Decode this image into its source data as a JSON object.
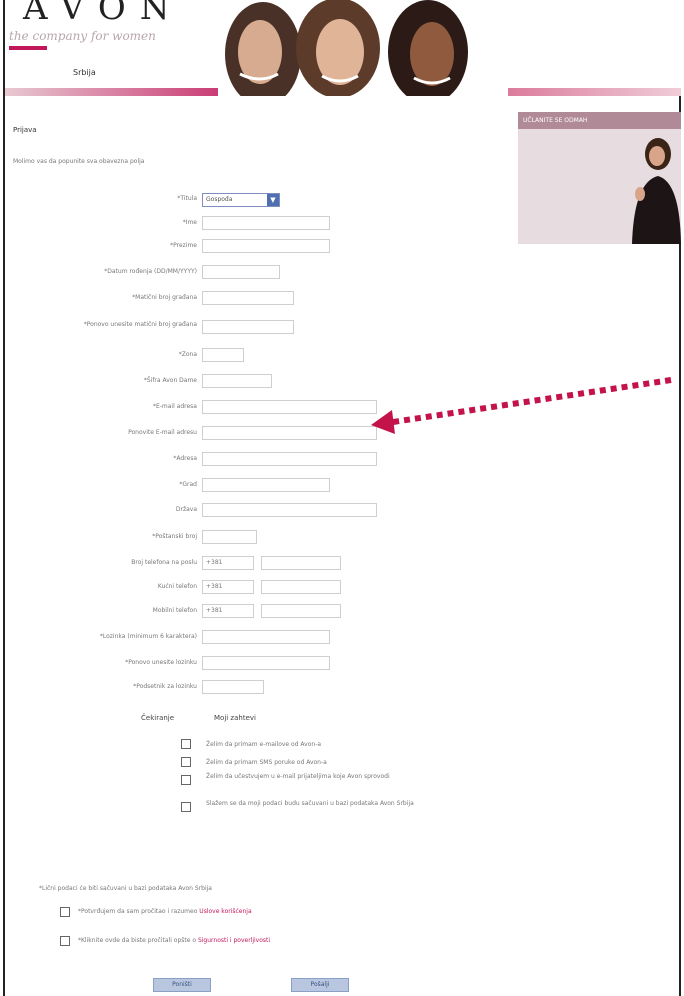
{
  "header": {
    "logo": "AVON",
    "tagline": "the company for women",
    "country": "Srbija"
  },
  "form": {
    "title": "Prijava",
    "note": "Molimo vas da popunite sva obavezna polja",
    "fields": [
      {
        "label": "*Titula",
        "value": "Gospođa"
      },
      {
        "label": "*Ime",
        "value": ""
      },
      {
        "label": "*Prezime",
        "value": ""
      },
      {
        "label": "*Datum rođenja (DD/MM/YYYY)",
        "value": ""
      },
      {
        "label": "*Matični broj građana",
        "value": ""
      },
      {
        "label": "*Ponovo unesite matični broj građana",
        "value": ""
      },
      {
        "label": "*Zona",
        "value": ""
      },
      {
        "label": "*Šifra Avon Dame",
        "value": ""
      },
      {
        "label": "*E-mail adresa",
        "value": ""
      },
      {
        "label": "Ponovite E-mail adresu",
        "value": ""
      },
      {
        "label": "*Adresa",
        "value": ""
      },
      {
        "label": "*Grad",
        "value": ""
      },
      {
        "label": "Država",
        "value": ""
      },
      {
        "label": "*Poštanski broj",
        "value": ""
      },
      {
        "label": "Broj telefona na poslu",
        "value": "+381"
      },
      {
        "label": "Kućni telefon",
        "value": "+381"
      },
      {
        "label": "Mobilni telefon",
        "value": "+381"
      },
      {
        "label": "*Lozinka (minimum 6 karaktera)",
        "value": ""
      },
      {
        "label": "*Ponovo unesite lozinku",
        "value": ""
      },
      {
        "label": "*Podsetnik za lozinku",
        "value": ""
      }
    ]
  },
  "sidebar": {
    "title": "UČLANITE SE ODMAH"
  },
  "preferences": {
    "left_label": "Čekiranje",
    "right_label": "Moji zahtevi",
    "items": [
      "Želim da primam e-mailove od Avon-a",
      "Želim da primam SMS poruke od Avon-a",
      "Želim da učestvujem u e-mail prijateljima koje Avon sprovodi",
      "Slažem se da moji podaci budu sačuvani u bazi podataka Avon Srbija"
    ]
  },
  "consent": {
    "intro": "*Lični podaci će biti sačuvani u bazi podataka Avon Srbija",
    "items": [
      {
        "text": "*Potvrđujem da sam pročitao i razumeo ",
        "link": "Uslove korišćenja"
      },
      {
        "text": "*Kliknite ovde da biste pročitali opšte o ",
        "link": "Sigurnosti i poverljivosti"
      }
    ]
  },
  "buttons": {
    "reset": "Poništi",
    "submit": "Pošalji"
  },
  "colors": {
    "accent": "#c2185b",
    "arrow": "#c4124a"
  }
}
